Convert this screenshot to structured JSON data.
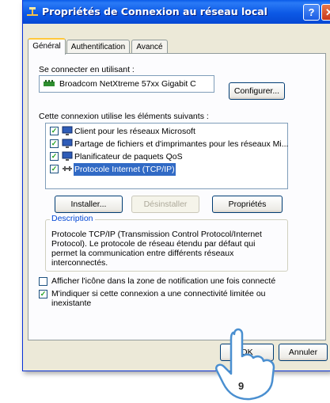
{
  "window": {
    "title": "Propriétés de Connexion au réseau local",
    "help_label": "?",
    "close_label": "✕"
  },
  "tabs": [
    {
      "label": "Général",
      "active": true
    },
    {
      "label": "Authentification",
      "active": false
    },
    {
      "label": "Avancé",
      "active": false
    }
  ],
  "connect_using": {
    "label": "Se connecter en utilisant :",
    "adapter": "Broadcom NetXtreme 57xx Gigabit C",
    "configure_button": "Configurer..."
  },
  "components": {
    "label": "Cette connexion utilise les éléments suivants :",
    "items": [
      {
        "label": "Client pour les réseaux Microsoft",
        "checked": true,
        "icon": "network-client-icon",
        "selected": false
      },
      {
        "label": "Partage de fichiers et d'imprimantes pour les réseaux Mi...",
        "checked": true,
        "icon": "file-printer-sharing-icon",
        "selected": false
      },
      {
        "label": "Planificateur de paquets QoS",
        "checked": true,
        "icon": "qos-scheduler-icon",
        "selected": false
      },
      {
        "label": "Protocole Internet (TCP/IP)",
        "checked": true,
        "icon": "protocol-icon",
        "selected": true
      }
    ],
    "install_button": "Installer...",
    "uninstall_button": "Désinstaller",
    "properties_button": "Propriétés"
  },
  "description": {
    "title": "Description",
    "text": "Protocole TCP/IP (Transmission Control Protocol/Internet Protocol). Le protocole de réseau étendu par défaut qui permet la communication entre différents réseaux interconnectés."
  },
  "options": [
    {
      "label": "Afficher l'icône dans la zone de notification une fois connecté",
      "checked": false
    },
    {
      "label": "M'indiquer si cette connexion a une connectivité limitée ou inexistante",
      "checked": true
    }
  ],
  "footer": {
    "ok_button": "OK",
    "cancel_button": "Annuler"
  },
  "step_badge": "9",
  "colors": {
    "titlebar": "#0c59e6",
    "selection": "#316ac5",
    "group_title": "#0046d5",
    "window_bg": "#ece9d8"
  }
}
